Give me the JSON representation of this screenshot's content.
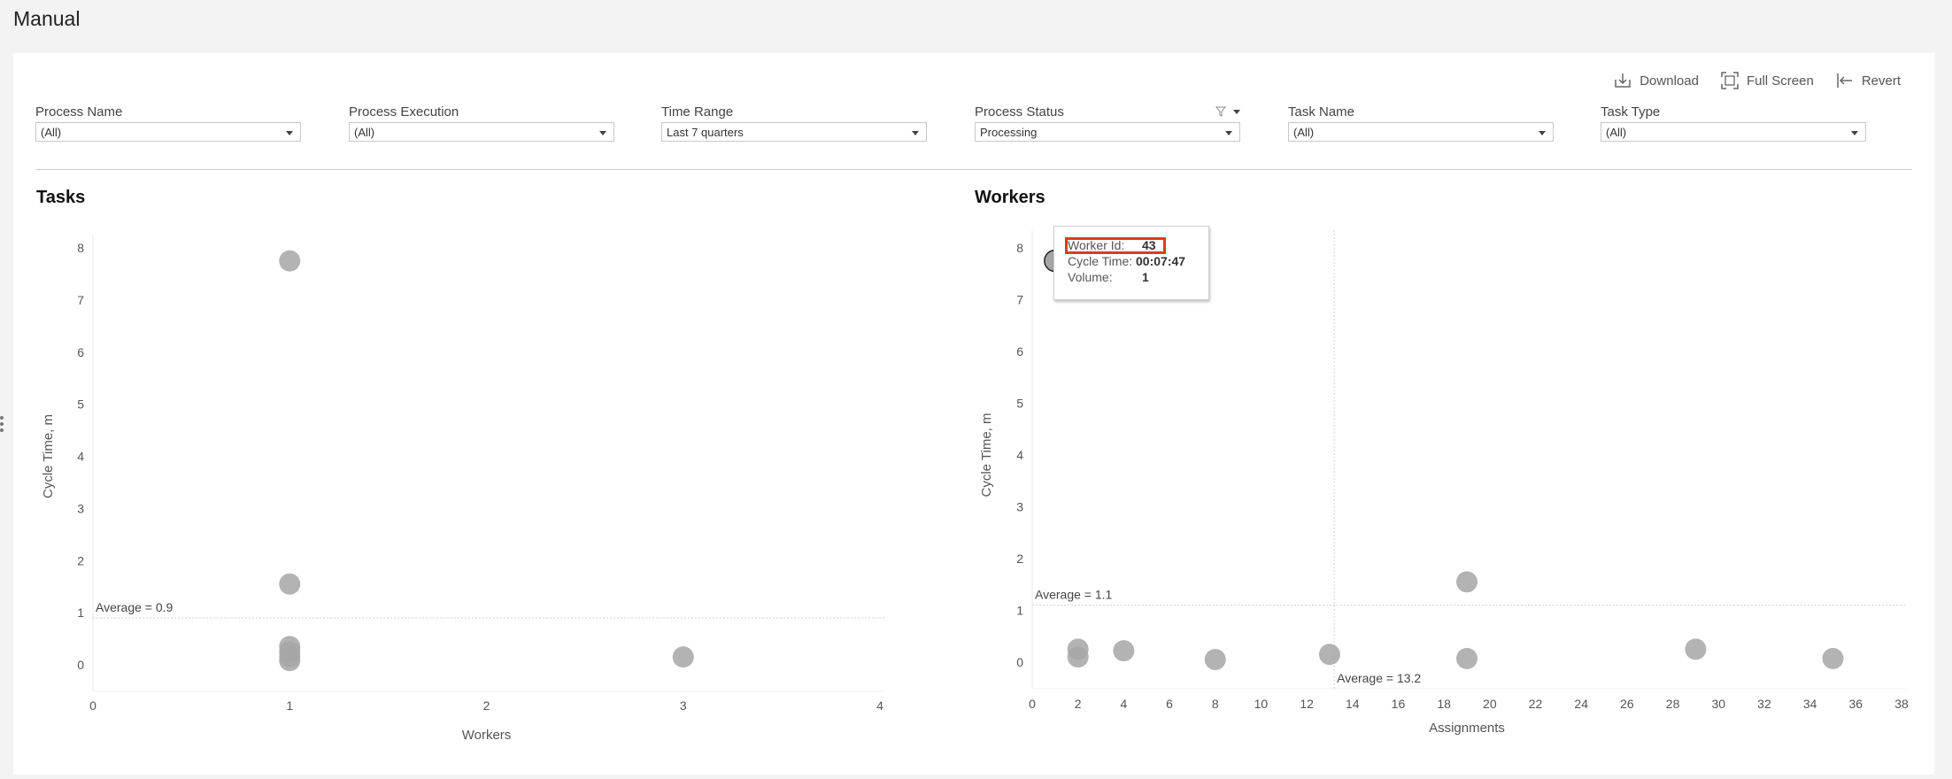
{
  "page": {
    "title": "Manual"
  },
  "toolbar": {
    "download": "Download",
    "fullscreen": "Full Screen",
    "revert": "Revert"
  },
  "filters": [
    {
      "label": "Process Name",
      "value": "(All)",
      "has_filter_icon": false
    },
    {
      "label": "Process Execution",
      "value": "(All)",
      "has_filter_icon": false
    },
    {
      "label": "Time Range",
      "value": "Last 7 quarters",
      "has_filter_icon": false
    },
    {
      "label": "Process Status",
      "value": "Processing",
      "has_filter_icon": true
    },
    {
      "label": "Task Name",
      "value": "(All)",
      "has_filter_icon": false
    },
    {
      "label": "Task Type",
      "value": "(All)",
      "has_filter_icon": false
    }
  ],
  "charts": {
    "tasks_title": "Tasks",
    "workers_title": "Workers"
  },
  "tooltip": {
    "worker_id_label": "Worker Id:",
    "worker_id_value": "43",
    "cycle_label": "Cycle Time:",
    "cycle_value": "00:07:47",
    "volume_label": "Volume:",
    "volume_value": "1"
  },
  "chart_data": [
    {
      "type": "scatter",
      "title": "Tasks",
      "xlabel": "Workers",
      "ylabel": "Cycle Time, m",
      "xlim": [
        0,
        4
      ],
      "ylim": [
        0,
        8
      ],
      "xticks": [
        0,
        1,
        2,
        3,
        4
      ],
      "yticks": [
        0,
        1,
        2,
        3,
        4,
        5,
        6,
        7,
        8
      ],
      "average_line": {
        "axis": "y",
        "value": 0.9,
        "label": "Average = 0.9"
      },
      "points": [
        {
          "x": 1,
          "y": 7.75
        },
        {
          "x": 1,
          "y": 1.55
        },
        {
          "x": 1,
          "y": 0.35
        },
        {
          "x": 1,
          "y": 0.25
        },
        {
          "x": 1,
          "y": 0.15
        },
        {
          "x": 1,
          "y": 0.08
        },
        {
          "x": 3,
          "y": 0.15
        }
      ],
      "point_color": "#a6a6a6"
    },
    {
      "type": "scatter",
      "title": "Workers",
      "xlabel": "Assignments",
      "ylabel": "Cycle Time, m",
      "xlim": [
        0,
        38
      ],
      "ylim": [
        0,
        8
      ],
      "xticks": [
        0,
        2,
        4,
        6,
        8,
        10,
        12,
        14,
        16,
        18,
        20,
        22,
        24,
        26,
        28,
        30,
        32,
        34,
        36,
        38
      ],
      "yticks": [
        0,
        1,
        2,
        3,
        4,
        5,
        6,
        7,
        8
      ],
      "average_line_y": {
        "value": 1.1,
        "label": "Average = 1.1"
      },
      "average_line_x": {
        "value": 13.2,
        "label": "Average = 13.2"
      },
      "points": [
        {
          "x": 1,
          "y": 7.75,
          "selected": true
        },
        {
          "x": 2,
          "y": 0.25
        },
        {
          "x": 2,
          "y": 0.1
        },
        {
          "x": 4,
          "y": 0.22
        },
        {
          "x": 8,
          "y": 0.05
        },
        {
          "x": 13,
          "y": 0.15
        },
        {
          "x": 19,
          "y": 1.55
        },
        {
          "x": 19,
          "y": 0.07
        },
        {
          "x": 29,
          "y": 0.25
        },
        {
          "x": 35,
          "y": 0.07
        }
      ],
      "point_color": "#a6a6a6"
    }
  ]
}
